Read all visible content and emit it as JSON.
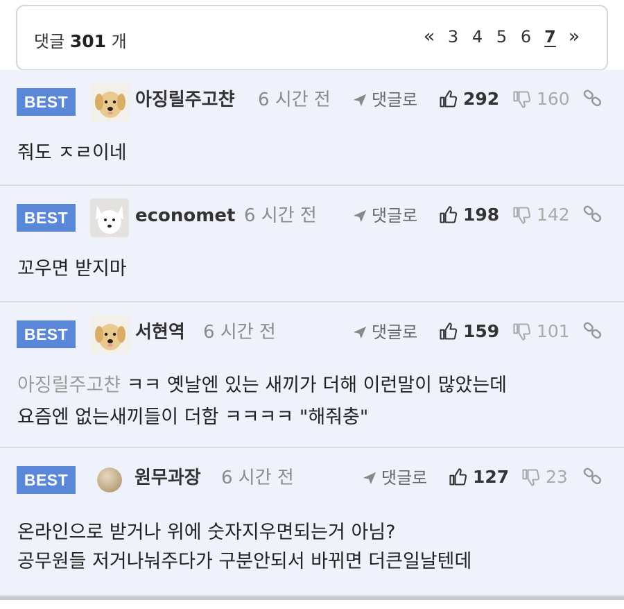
{
  "header": {
    "count_prefix": "댓글",
    "count_value": "301",
    "count_suffix": "개",
    "pager": {
      "prev": "«",
      "pages": [
        "3",
        "4",
        "5",
        "6"
      ],
      "current": "7",
      "next": "»"
    }
  },
  "labels": {
    "best": "BEST",
    "reply": "댓글로"
  },
  "comments": [
    {
      "nick": "아징릴주고챤",
      "time": "6 시간 전",
      "up": "292",
      "down": "160",
      "avatar": "dog-avatar",
      "text1": "줘도 ㅈㄹ이네"
    },
    {
      "nick": "economet",
      "time": "6 시간 전",
      "up": "198",
      "down": "142",
      "avatar": "white-dog-avatar",
      "text1": "꼬우면 받지마"
    },
    {
      "nick": "서현역",
      "time": "6 시간 전",
      "up": "159",
      "down": "101",
      "avatar": "dog-avatar",
      "mention": "아징릴주고챤",
      "text1": " ㅋㅋ 옛날엔 있는 새끼가 더해 이런말이 많았는데",
      "text2": "요즘엔 없는새끼들이 더함 ㅋㅋㅋㅋ \"해줘충\""
    },
    {
      "nick": "원무과장",
      "time": "6 시간 전",
      "up": "127",
      "down": "23",
      "avatar": "default-avatar",
      "text1": "온라인으로 받거나 위에 숫자지우면되는거 아님?",
      "text2": "공무원들 저거나눠주다가 구분안되서 바뀌면 더큰일날텐데"
    }
  ],
  "colors": {
    "best_badge": "#5a87d8",
    "comment_bg": "#f0f2fb",
    "mention": "#9a9a9a"
  }
}
